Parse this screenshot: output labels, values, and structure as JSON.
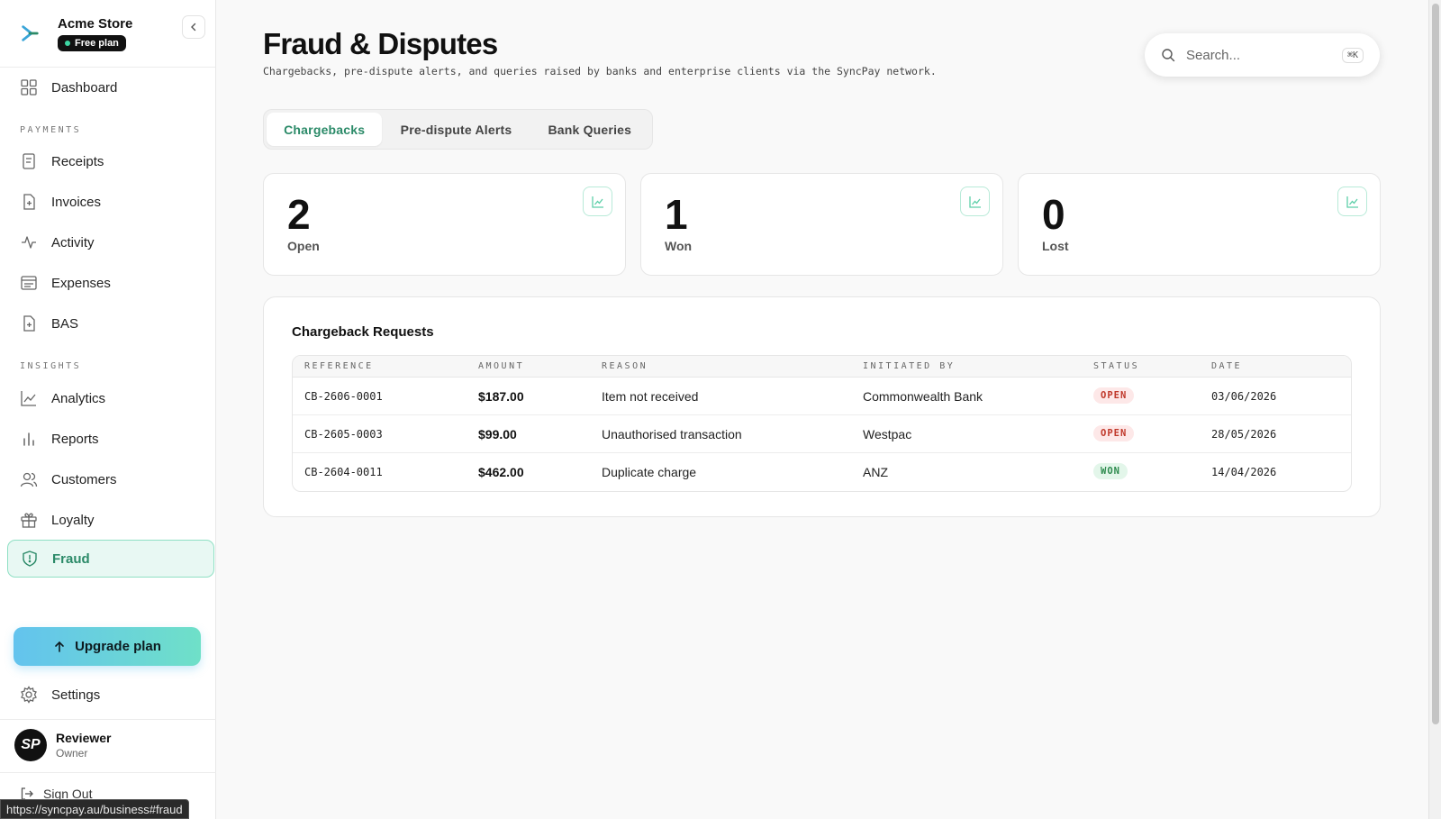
{
  "sidebar": {
    "brand_name": "Acme Store",
    "plan_badge": "Free plan",
    "items": [
      {
        "label": "Dashboard"
      },
      {
        "label": "Receipts"
      },
      {
        "label": "Invoices"
      },
      {
        "label": "Activity"
      },
      {
        "label": "Expenses"
      },
      {
        "label": "BAS"
      },
      {
        "label": "Analytics"
      },
      {
        "label": "Reports"
      },
      {
        "label": "Customers"
      },
      {
        "label": "Loyalty"
      },
      {
        "label": "Fraud"
      }
    ],
    "sections": {
      "payments": "PAYMENTS",
      "insights": "INSIGHTS"
    },
    "upgrade_label": "Upgrade plan",
    "settings_label": "Settings",
    "user_name": "Reviewer",
    "user_role": "Owner",
    "avatar_initials": "SP",
    "signout_label": "Sign Out",
    "status_url": "https://syncpay.au/business#fraud"
  },
  "header": {
    "title": "Fraud & Disputes",
    "subtitle": "Chargebacks, pre-dispute alerts, and queries raised by banks and enterprise clients via the SyncPay network.",
    "search_placeholder": "Search...",
    "search_shortcut": "⌘K"
  },
  "tabs": [
    {
      "label": "Chargebacks",
      "active": true
    },
    {
      "label": "Pre-dispute Alerts",
      "active": false
    },
    {
      "label": "Bank Queries",
      "active": false
    }
  ],
  "stats": [
    {
      "value": "2",
      "label": "Open"
    },
    {
      "value": "1",
      "label": "Won"
    },
    {
      "value": "0",
      "label": "Lost"
    }
  ],
  "table": {
    "title": "Chargeback Requests",
    "columns": [
      "REFERENCE",
      "AMOUNT",
      "REASON",
      "INITIATED BY",
      "STATUS",
      "DATE"
    ],
    "rows": [
      {
        "reference": "CB-2606-0001",
        "amount": "$187.00",
        "reason": "Item not received",
        "initiated_by": "Commonwealth Bank",
        "status": "OPEN",
        "date": "03/06/2026"
      },
      {
        "reference": "CB-2605-0003",
        "amount": "$99.00",
        "reason": "Unauthorised transaction",
        "initiated_by": "Westpac",
        "status": "OPEN",
        "date": "28/05/2026"
      },
      {
        "reference": "CB-2604-0011",
        "amount": "$462.00",
        "reason": "Duplicate charge",
        "initiated_by": "ANZ",
        "status": "WON",
        "date": "14/04/2026"
      }
    ]
  },
  "colors": {
    "accent": "#2b8a68",
    "active_bg": "#e8f8f3",
    "open_badge": "#c0392b",
    "won_badge": "#2e8b4e"
  }
}
